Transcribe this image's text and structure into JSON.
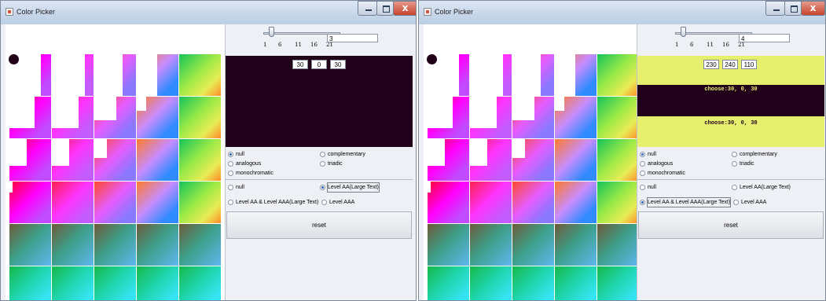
{
  "windows": [
    {
      "title": "Color Picker",
      "slider": {
        "ticks": [
          "1",
          "6",
          "11",
          "16",
          "21"
        ],
        "value": "3"
      },
      "rgb": {
        "r": "30",
        "g": "0",
        "b": "30"
      },
      "harmony_options": {
        "null": "null",
        "complementary": "complementary",
        "analogous": "analogous",
        "triadic": "triadic",
        "monochromatic": "monochromatic"
      },
      "contrast_options": {
        "null": "null",
        "aa_large": "Level AA(Large Text)",
        "aa_aaa_large": "Level AA & Level AAA(Large Text)",
        "aaa": "Level AAA"
      },
      "selected_harmony": "null",
      "selected_contrast": "aa_large",
      "reset_label": "reset",
      "close_label": "x"
    },
    {
      "title": "Color Picker",
      "slider": {
        "ticks": [
          "1",
          "6",
          "11",
          "16",
          "21"
        ],
        "value": "4"
      },
      "rgb": {
        "r": "230",
        "g": "240",
        "b": "110"
      },
      "choose_text_1": "choose:30, 0, 30",
      "choose_text_2": "choose:30, 0, 30",
      "harmony_options": {
        "null": "null",
        "complementary": "complementary",
        "analogous": "analogous",
        "triadic": "triadic",
        "monochromatic": "monochromatic"
      },
      "contrast_options": {
        "null": "null",
        "aa_large": "Level AA(Large Text)",
        "aa_aaa_large": "Level AA & Level AAA(Large Text)",
        "aaa": "Level AAA"
      },
      "selected_harmony": "null",
      "selected_contrast": "aa_aaa_large",
      "reset_label": "reset",
      "close_label": "x"
    }
  ],
  "colors": {
    "chosen": "#210019",
    "preview_2": "#e6f06e",
    "choose_text_1": "#e6f06e",
    "choose_text_2": "#210019"
  }
}
